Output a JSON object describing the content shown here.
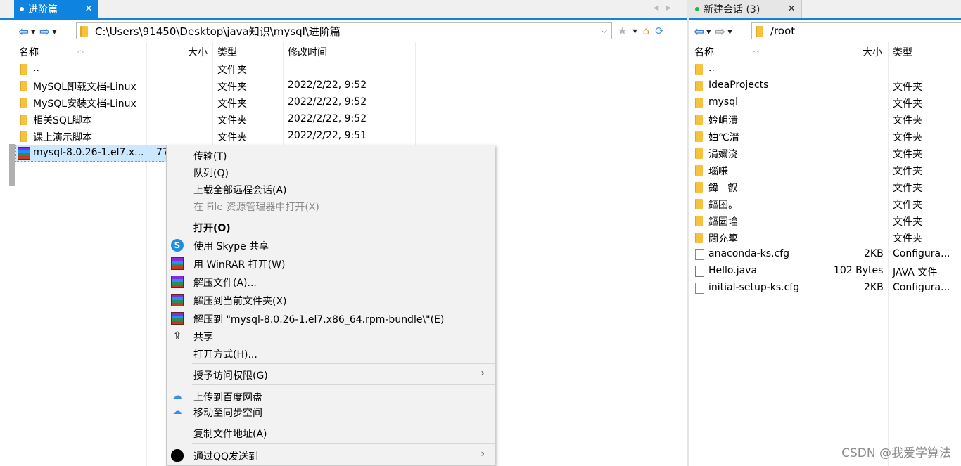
{
  "left": {
    "tab_label": "进阶篇",
    "tab_close": "×",
    "path": "C:\\Users\\91450\\Desktop\\java知识\\mysql\\进阶篇",
    "columns": {
      "name": "名称",
      "size": "大小",
      "type": "类型",
      "modified": "修改时间"
    },
    "rows": [
      {
        "name": "..",
        "size": "",
        "type": "文件夹",
        "modified": ""
      },
      {
        "name": "MySQL卸载文档-Linux",
        "size": "",
        "type": "文件夹",
        "modified": "2022/2/22, 9:52"
      },
      {
        "name": "MySQL安装文档-Linux",
        "size": "",
        "type": "文件夹",
        "modified": "2022/2/22, 9:52"
      },
      {
        "name": "相关SQL脚本",
        "size": "",
        "type": "文件夹",
        "modified": "2022/2/22, 9:52"
      },
      {
        "name": "课上演示脚本",
        "size": "",
        "type": "文件夹",
        "modified": "2022/2/22, 9:51"
      },
      {
        "name": "mysql-8.0.26-1.el7.x...",
        "size": "77",
        "type": "",
        "modified": ""
      }
    ]
  },
  "right": {
    "tab_label": "新建会话 (3)",
    "tab_close": "×",
    "path": "/root",
    "columns": {
      "name": "名称",
      "size": "大小",
      "type": "类型"
    },
    "rows": [
      {
        "name": "..",
        "size": "",
        "type": "",
        "kind": "folder"
      },
      {
        "name": "IdeaProjects",
        "size": "",
        "type": "文件夹",
        "kind": "folder"
      },
      {
        "name": "mysql",
        "size": "",
        "type": "文件夹",
        "kind": "folder"
      },
      {
        "name": "妗岄潰",
        "size": "",
        "type": "文件夹",
        "kind": "folder"
      },
      {
        "name": "妯℃澘",
        "size": "",
        "type": "文件夹",
        "kind": "folder"
      },
      {
        "name": "涓嬭浇",
        "size": "",
        "type": "文件夹",
        "kind": "folder"
      },
      {
        "name": "瑙嗛",
        "size": "",
        "type": "文件夹",
        "kind": "folder"
      },
      {
        "name": "鍏   叡",
        "size": "",
        "type": "文件夹",
        "kind": "folder"
      },
      {
        "name": "鏂囨。",
        "size": "",
        "type": "文件夹",
        "kind": "folder"
      },
      {
        "name": "鏂囩墖",
        "size": "",
        "type": "文件夹",
        "kind": "folder"
      },
      {
        "name": "闊充箰",
        "size": "",
        "type": "文件夹",
        "kind": "folder"
      },
      {
        "name": "anaconda-ks.cfg",
        "size": "2KB",
        "type": "Configura...",
        "kind": "cfg"
      },
      {
        "name": "Hello.java",
        "size": "102 Bytes",
        "type": "JAVA 文件",
        "kind": "file"
      },
      {
        "name": "initial-setup-ks.cfg",
        "size": "2KB",
        "type": "Configura...",
        "kind": "cfg"
      }
    ]
  },
  "context_menu": {
    "items": [
      {
        "label": "传输(T)",
        "icon": "",
        "state": "normal"
      },
      {
        "label": "队列(Q)",
        "icon": "",
        "state": "normal"
      },
      {
        "label": "上载全部远程会话(A)",
        "icon": "",
        "state": "normal"
      },
      {
        "label": "在 File 资源管理器中打开(X)",
        "icon": "",
        "state": "disabled"
      },
      {
        "label": "打开(O)",
        "icon": "",
        "state": "bold"
      },
      {
        "label": "使用 Skype 共享",
        "icon": "skype-icon",
        "state": "normal"
      },
      {
        "label": "用 WinRAR 打开(W)",
        "icon": "winrar-icon",
        "state": "normal"
      },
      {
        "label": "解压文件(A)...",
        "icon": "winrar-icon",
        "state": "normal"
      },
      {
        "label": "解压到当前文件夹(X)",
        "icon": "winrar-icon",
        "state": "normal"
      },
      {
        "label": "解压到 \"mysql-8.0.26-1.el7.x86_64.rpm-bundle\\\"(E)",
        "icon": "winrar-icon",
        "state": "normal"
      },
      {
        "label": "共享",
        "icon": "share-icon",
        "state": "normal"
      },
      {
        "label": "打开方式(H)...",
        "icon": "",
        "state": "normal"
      },
      {
        "label": "授予访问权限(G)",
        "icon": "",
        "state": "submenu"
      },
      {
        "label": "上传到百度网盘",
        "icon": "baidu-netdisk-icon",
        "state": "normal"
      },
      {
        "label": "移动至同步空间",
        "icon": "baidu-netdisk-icon",
        "state": "normal"
      },
      {
        "label": "复制文件地址(A)",
        "icon": "",
        "state": "normal"
      },
      {
        "label": "通过QQ发送到",
        "icon": "qq-icon",
        "state": "submenu"
      }
    ]
  },
  "watermark": "CSDN @我爱学算法",
  "colors": {
    "accent": "#0f83e0",
    "selection": "#cce8ff",
    "folder": "#f7c33e"
  }
}
